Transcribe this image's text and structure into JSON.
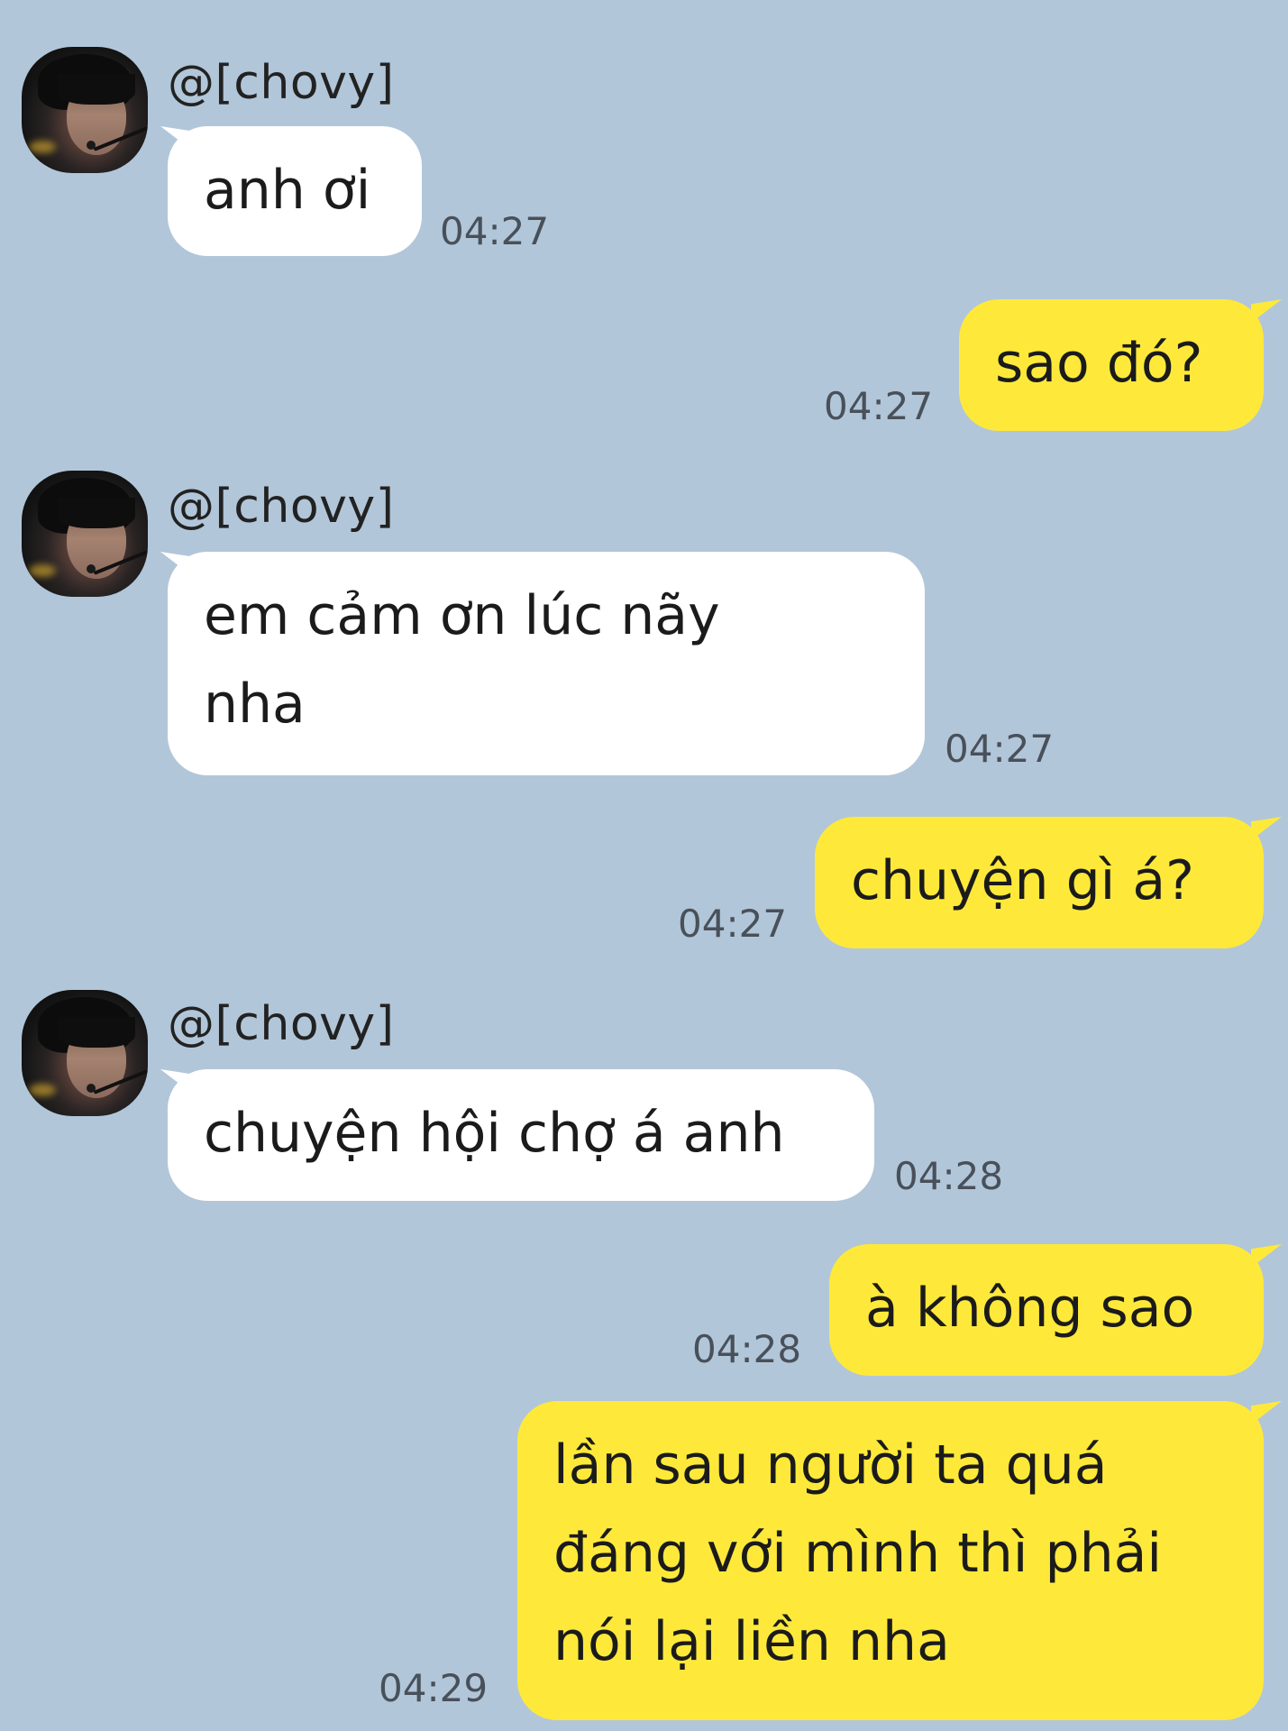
{
  "contact": {
    "name": "@[chovy]"
  },
  "messages": [
    {
      "sender": "contact",
      "text": "anh ơi",
      "time": "04:27"
    },
    {
      "sender": "me",
      "text": "sao đó?",
      "time": "04:27"
    },
    {
      "sender": "contact",
      "lines": [
        "em cảm ơn lúc nãy",
        "nha"
      ],
      "time": "04:27"
    },
    {
      "sender": "me",
      "text": "chuyện gì á?",
      "time": "04:27"
    },
    {
      "sender": "contact",
      "text": "chuyện hội chợ á anh",
      "time": "04:28"
    },
    {
      "sender": "me",
      "text": "à không sao",
      "time": "04:28"
    },
    {
      "sender": "me",
      "lines": [
        "lần sau người ta quá",
        "đáng với mình thì phải",
        "nói lại liền nha"
      ],
      "time": "04:29"
    }
  ],
  "colors": {
    "background": "#b2c6d9",
    "incoming_bubble": "#ffffff",
    "outgoing_bubble": "#fee93a"
  }
}
